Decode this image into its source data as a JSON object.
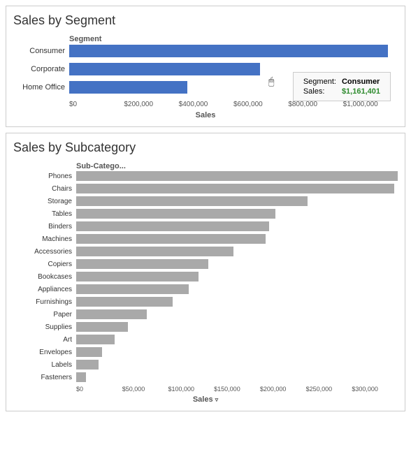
{
  "segment_chart": {
    "title": "Sales by Segment",
    "axis_label": "Segment",
    "x_axis_title": "Sales",
    "bars": [
      {
        "label": "Consumer",
        "value": 1161401,
        "max": 1200000,
        "color": "blue",
        "pct": 96.8
      },
      {
        "label": "Corporate",
        "value": 706146,
        "max": 1200000,
        "color": "blue",
        "pct": 58.8
      },
      {
        "label": "Home Office",
        "value": 429653,
        "max": 1200000,
        "color": "blue",
        "pct": 35.8
      }
    ],
    "x_ticks": [
      "$0",
      "$200,000",
      "$400,000",
      "$600,000",
      "$800,000",
      "$1,000,000"
    ],
    "tooltip": {
      "segment_label": "Segment:",
      "segment_value": "Consumer",
      "sales_label": "Sales:",
      "sales_value": "$1,161,401"
    }
  },
  "subcategory_chart": {
    "title": "Sales by Subcategory",
    "axis_label": "Sub-Catego...",
    "x_axis_title": "Sales",
    "bars": [
      {
        "label": "Phones",
        "pct": 100
      },
      {
        "label": "Chairs",
        "pct": 99
      },
      {
        "label": "Storage",
        "pct": 72
      },
      {
        "label": "Tables",
        "pct": 62
      },
      {
        "label": "Binders",
        "pct": 60
      },
      {
        "label": "Machines",
        "pct": 59
      },
      {
        "label": "Accessories",
        "pct": 49
      },
      {
        "label": "Copiers",
        "pct": 41
      },
      {
        "label": "Bookcases",
        "pct": 38
      },
      {
        "label": "Appliances",
        "pct": 35
      },
      {
        "label": "Furnishings",
        "pct": 30
      },
      {
        "label": "Paper",
        "pct": 22
      },
      {
        "label": "Supplies",
        "pct": 16
      },
      {
        "label": "Art",
        "pct": 12
      },
      {
        "label": "Envelopes",
        "pct": 8
      },
      {
        "label": "Labels",
        "pct": 7
      },
      {
        "label": "Fasteners",
        "pct": 3
      }
    ],
    "x_ticks": [
      "$0",
      "$50,000",
      "$100,000",
      "$150,000",
      "$200,000",
      "$250,000",
      "$300,000"
    ]
  }
}
